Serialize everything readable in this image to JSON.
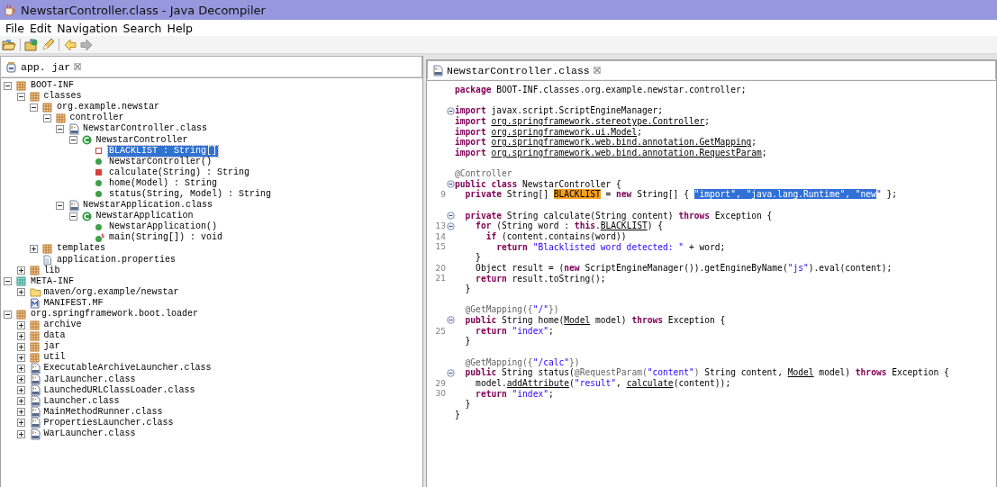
{
  "window": {
    "title": "NewstarController.class - Java Decompiler"
  },
  "menu": [
    "File",
    "Edit",
    "Navigation",
    "Search",
    "Help"
  ],
  "toolbar": [
    {
      "kind": "open-file",
      "disabled": false
    },
    {
      "kind": "open-type",
      "disabled": false
    },
    {
      "kind": "search",
      "disabled": false
    },
    {
      "kind": "back",
      "disabled": false
    },
    {
      "kind": "forward",
      "disabled": true
    }
  ],
  "archive_tabs": [
    {
      "label": "app. jar",
      "selected": true
    }
  ],
  "tree": [
    {
      "label": "BOOT-INF",
      "kind": "package",
      "expanded": true,
      "selected": false,
      "children": [
        {
          "label": "classes",
          "kind": "package",
          "expanded": true,
          "selected": false,
          "children": [
            {
              "label": "org.example.newstar",
              "kind": "package",
              "expanded": true,
              "selected": false,
              "children": [
                {
                  "label": "controller",
                  "kind": "package",
                  "expanded": true,
                  "selected": false,
                  "children": [
                    {
                      "label": "NewstarController.class",
                      "kind": "class-file",
                      "expanded": true,
                      "selected": false,
                      "children": [
                        {
                          "label": "NewstarController",
                          "kind": "class",
                          "expanded": true,
                          "selected": false,
                          "children": [
                            {
                              "label": "BLACKLIST : String[]",
                              "kind": "private-field",
                              "selected": true
                            },
                            {
                              "label": "NewstarController()",
                              "kind": "public-method",
                              "selected": false
                            },
                            {
                              "label": "calculate(String) : String",
                              "kind": "private-method",
                              "selected": false
                            },
                            {
                              "label": "home(Model) : String",
                              "kind": "public-method",
                              "selected": false
                            },
                            {
                              "label": "status(String, Model) : String",
                              "kind": "public-method",
                              "selected": false
                            }
                          ]
                        }
                      ]
                    },
                    {
                      "label": "NewstarApplication.class",
                      "kind": "class-file",
                      "expanded": true,
                      "selected": false,
                      "children": [
                        {
                          "label": "NewstarApplication",
                          "kind": "class",
                          "expanded": true,
                          "selected": false,
                          "children": [
                            {
                              "label": "NewstarApplication()",
                              "kind": "public-method",
                              "selected": false
                            },
                            {
                              "label": "main(String[]) : void",
                              "kind": "static-method",
                              "selected": false
                            }
                          ]
                        }
                      ]
                    }
                  ]
                }
              ]
            },
            {
              "label": "templates",
              "kind": "package",
              "expanded": false,
              "selected": false
            },
            {
              "label": "application.properties",
              "kind": "file",
              "selected": false
            }
          ]
        },
        {
          "label": "lib",
          "kind": "package",
          "expanded": false,
          "selected": false
        }
      ]
    },
    {
      "label": "META-INF",
      "kind": "meta-package",
      "expanded": true,
      "selected": false,
      "children": [
        {
          "label": "maven/org.example/newstar",
          "kind": "folder",
          "expanded": false,
          "selected": false
        },
        {
          "label": "MANIFEST.MF",
          "kind": "manifest",
          "selected": false
        }
      ]
    },
    {
      "label": "org.springframework.boot.loader",
      "kind": "package",
      "expanded": true,
      "selected": false,
      "children": [
        {
          "label": "archive",
          "kind": "package",
          "expanded": false,
          "selected": false
        },
        {
          "label": "data",
          "kind": "package",
          "expanded": false,
          "selected": false
        },
        {
          "label": "jar",
          "kind": "package",
          "expanded": false,
          "selected": false
        },
        {
          "label": "util",
          "kind": "package",
          "expanded": false,
          "selected": false
        },
        {
          "label": "ExecutableArchiveLauncher.class",
          "kind": "class-file",
          "expanded": false,
          "selected": false
        },
        {
          "label": "JarLauncher.class",
          "kind": "class-file",
          "expanded": false,
          "selected": false
        },
        {
          "label": "LaunchedURLClassLoader.class",
          "kind": "class-file",
          "expanded": false,
          "selected": false
        },
        {
          "label": "Launcher.class",
          "kind": "class-file",
          "expanded": false,
          "selected": false
        },
        {
          "label": "MainMethodRunner.class",
          "kind": "class-file",
          "expanded": false,
          "selected": false
        },
        {
          "label": "PropertiesLauncher.class",
          "kind": "class-file",
          "expanded": false,
          "selected": false
        },
        {
          "label": "WarLauncher.class",
          "kind": "class-file",
          "expanded": false,
          "selected": false
        }
      ]
    }
  ],
  "editor_tabs": [
    {
      "label": "NewstarController.class",
      "selected": true
    }
  ],
  "code": [
    {
      "kind": "code",
      "tokens": [
        {
          "kind": "keyword",
          "text": "package"
        },
        {
          "kind": "plain",
          "text": " BOOT-INF.classes.org.example.newstar.controller;"
        }
      ]
    },
    {
      "kind": "blank"
    },
    {
      "kind": "code",
      "fold": true,
      "tokens": [
        {
          "kind": "keyword",
          "text": "import"
        },
        {
          "kind": "plain",
          "text": " javax.script.ScriptEngineManager;"
        }
      ]
    },
    {
      "kind": "code",
      "tokens": [
        {
          "kind": "keyword",
          "text": "import "
        },
        {
          "kind": "link",
          "text": "org.springframework.stereotype.Controller"
        },
        {
          "kind": "plain",
          "text": ";"
        }
      ]
    },
    {
      "kind": "code",
      "tokens": [
        {
          "kind": "keyword",
          "text": "import "
        },
        {
          "kind": "link",
          "text": "org.springframework.ui.Model"
        },
        {
          "kind": "plain",
          "text": ";"
        }
      ]
    },
    {
      "kind": "code",
      "tokens": [
        {
          "kind": "keyword",
          "text": "import "
        },
        {
          "kind": "link",
          "text": "org.springframework.web.bind.annotation.GetMapping"
        },
        {
          "kind": "plain",
          "text": ";"
        }
      ]
    },
    {
      "kind": "code",
      "tokens": [
        {
          "kind": "keyword",
          "text": "import "
        },
        {
          "kind": "link",
          "text": "org.springframework.web.bind.annotation.RequestParam"
        },
        {
          "kind": "plain",
          "text": ";"
        }
      ]
    },
    {
      "kind": "blank"
    },
    {
      "kind": "code",
      "tokens": [
        {
          "kind": "annotation",
          "text": "@Controller"
        }
      ]
    },
    {
      "kind": "code",
      "fold": true,
      "tokens": [
        {
          "kind": "keyword",
          "text": "public class"
        },
        {
          "kind": "plain",
          "text": " NewstarController {"
        }
      ]
    },
    {
      "kind": "code",
      "number": "9",
      "tokens": [
        {
          "kind": "keyword",
          "text": "  private"
        },
        {
          "kind": "plain",
          "text": " String[] "
        },
        {
          "kind": "highlight",
          "text": "BLACKLIST"
        },
        {
          "kind": "plain",
          "text": " = "
        },
        {
          "kind": "keyword",
          "text": "new"
        },
        {
          "kind": "plain",
          "text": " String[] { "
        },
        {
          "kind": "selection",
          "text": "\"import\", \"java.lang.Runtime\", \"new"
        },
        {
          "kind": "string",
          "text": "\""
        },
        {
          "kind": "plain",
          "text": " };"
        }
      ]
    },
    {
      "kind": "blank"
    },
    {
      "kind": "code",
      "fold": true,
      "tokens": [
        {
          "kind": "keyword",
          "text": "  private"
        },
        {
          "kind": "plain",
          "text": " String calculate(String content) "
        },
        {
          "kind": "keyword",
          "text": "throws"
        },
        {
          "kind": "plain",
          "text": " Exception {"
        }
      ]
    },
    {
      "kind": "code",
      "number": "13",
      "fold": true,
      "tokens": [
        {
          "kind": "keyword",
          "text": "    for"
        },
        {
          "kind": "plain",
          "text": " (String word : "
        },
        {
          "kind": "keyword",
          "text": "this"
        },
        {
          "kind": "plain",
          "text": "."
        },
        {
          "kind": "link",
          "text": "BLACKLIST"
        },
        {
          "kind": "plain",
          "text": ") {"
        }
      ]
    },
    {
      "kind": "code",
      "number": "14",
      "tokens": [
        {
          "kind": "keyword",
          "text": "      if"
        },
        {
          "kind": "plain",
          "text": " (content.contains(word))"
        }
      ]
    },
    {
      "kind": "code",
      "number": "15",
      "tokens": [
        {
          "kind": "keyword",
          "text": "        return "
        },
        {
          "kind": "string",
          "text": "\"Blacklisted word detected: \""
        },
        {
          "kind": "plain",
          "text": " + word;"
        }
      ]
    },
    {
      "kind": "code",
      "tokens": [
        {
          "kind": "plain",
          "text": "    }"
        }
      ]
    },
    {
      "kind": "code",
      "number": "20",
      "tokens": [
        {
          "kind": "plain",
          "text": "    Object result = ("
        },
        {
          "kind": "keyword",
          "text": "new"
        },
        {
          "kind": "plain",
          "text": " ScriptEngineManager()).getEngineByName("
        },
        {
          "kind": "string",
          "text": "\"js\""
        },
        {
          "kind": "plain",
          "text": ").eval(content);"
        }
      ]
    },
    {
      "kind": "code",
      "number": "21",
      "tokens": [
        {
          "kind": "keyword",
          "text": "    return"
        },
        {
          "kind": "plain",
          "text": " result.toString();"
        }
      ]
    },
    {
      "kind": "code",
      "tokens": [
        {
          "kind": "plain",
          "text": "  }"
        }
      ]
    },
    {
      "kind": "blank"
    },
    {
      "kind": "code",
      "tokens": [
        {
          "kind": "annotation",
          "text": "  @GetMapping({"
        },
        {
          "kind": "string",
          "text": "\"/\""
        },
        {
          "kind": "annotation",
          "text": "})"
        }
      ]
    },
    {
      "kind": "code",
      "fold": true,
      "tokens": [
        {
          "kind": "keyword",
          "text": "  public"
        },
        {
          "kind": "plain",
          "text": " String home("
        },
        {
          "kind": "link",
          "text": "Model"
        },
        {
          "kind": "plain",
          "text": " model) "
        },
        {
          "kind": "keyword",
          "text": "throws"
        },
        {
          "kind": "plain",
          "text": " Exception {"
        }
      ]
    },
    {
      "kind": "code",
      "number": "25",
      "tokens": [
        {
          "kind": "keyword",
          "text": "    return "
        },
        {
          "kind": "string",
          "text": "\"index\""
        },
        {
          "kind": "plain",
          "text": ";"
        }
      ]
    },
    {
      "kind": "code",
      "tokens": [
        {
          "kind": "plain",
          "text": "  }"
        }
      ]
    },
    {
      "kind": "blank"
    },
    {
      "kind": "code",
      "tokens": [
        {
          "kind": "annotation",
          "text": "  @GetMapping({"
        },
        {
          "kind": "string",
          "text": "\"/calc\""
        },
        {
          "kind": "annotation",
          "text": "})"
        }
      ]
    },
    {
      "kind": "code",
      "fold": true,
      "tokens": [
        {
          "kind": "keyword",
          "text": "  public"
        },
        {
          "kind": "plain",
          "text": " String status("
        },
        {
          "kind": "annotation",
          "text": "@RequestParam("
        },
        {
          "kind": "string",
          "text": "\"content\""
        },
        {
          "kind": "annotation",
          "text": ")"
        },
        {
          "kind": "plain",
          "text": " String content, "
        },
        {
          "kind": "link",
          "text": "Model"
        },
        {
          "kind": "plain",
          "text": " model) "
        },
        {
          "kind": "keyword",
          "text": "throws"
        },
        {
          "kind": "plain",
          "text": " Exception {"
        }
      ]
    },
    {
      "kind": "code",
      "number": "29",
      "tokens": [
        {
          "kind": "plain",
          "text": "    model."
        },
        {
          "kind": "link",
          "text": "addAttribute"
        },
        {
          "kind": "plain",
          "text": "("
        },
        {
          "kind": "string",
          "text": "\"result\""
        },
        {
          "kind": "plain",
          "text": ", "
        },
        {
          "kind": "link",
          "text": "calculate"
        },
        {
          "kind": "plain",
          "text": "(content));"
        }
      ]
    },
    {
      "kind": "code",
      "number": "30",
      "tokens": [
        {
          "kind": "keyword",
          "text": "    return "
        },
        {
          "kind": "string",
          "text": "\"index\""
        },
        {
          "kind": "plain",
          "text": ";"
        }
      ]
    },
    {
      "kind": "code",
      "tokens": [
        {
          "kind": "plain",
          "text": "  }"
        }
      ]
    },
    {
      "kind": "code",
      "tokens": [
        {
          "kind": "plain",
          "text": "}"
        }
      ]
    }
  ]
}
